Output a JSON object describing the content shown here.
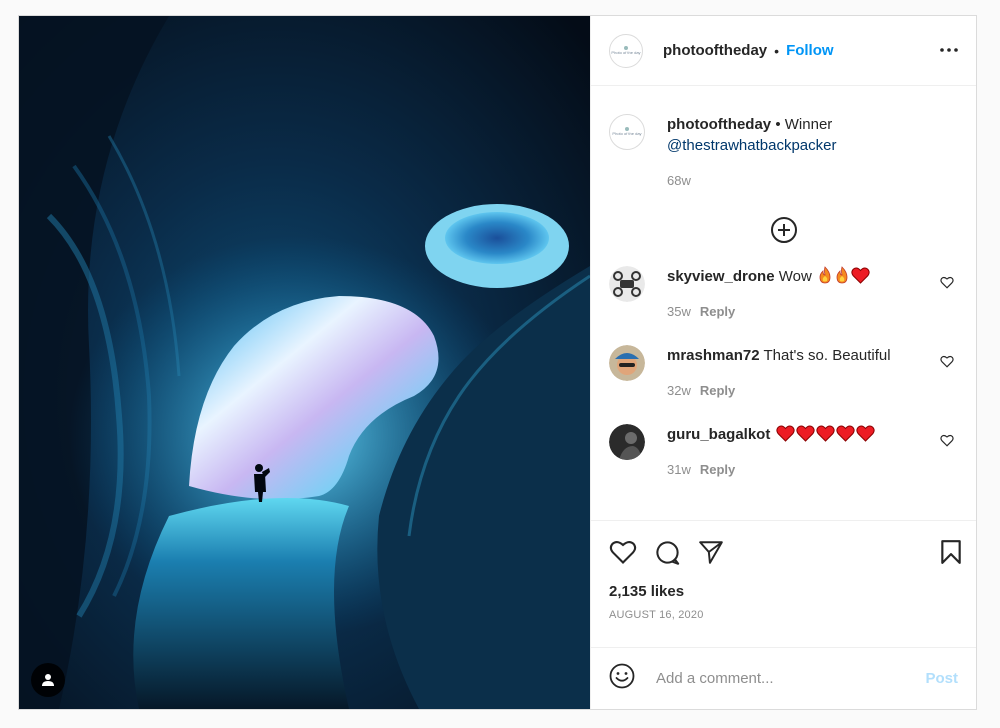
{
  "header": {
    "username": "photooftheday",
    "separator": "•",
    "follow_label": "Follow",
    "more_label": "•••",
    "avatar_text": "Photo of the day"
  },
  "caption": {
    "username": "photooftheday",
    "separator": "•",
    "text": "Winner",
    "mention": "@thestrawhatbackpacker",
    "time": "68w"
  },
  "comments": [
    {
      "username": "skyview_drone",
      "text": "Wow",
      "emojis": [
        "fire-emoji",
        "fire-emoji",
        "heart-emoji"
      ],
      "time": "35w",
      "reply_label": "Reply"
    },
    {
      "username": "mrashman72",
      "text": "That's so. Beautiful",
      "emojis": [],
      "time": "32w",
      "reply_label": "Reply"
    },
    {
      "username": "guru_bagalkot",
      "text": "",
      "emojis": [
        "heart-emoji",
        "heart-emoji",
        "heart-emoji",
        "heart-emoji",
        "heart-emoji"
      ],
      "time": "31w",
      "reply_label": "Reply"
    }
  ],
  "actions": {
    "icons": [
      "heart-outline-icon",
      "comment-icon",
      "share-icon",
      "bookmark-icon"
    ]
  },
  "likes": "2,135 likes",
  "date": "AUGUST 16, 2020",
  "add_comment": {
    "placeholder": "Add a comment...",
    "post_label": "Post"
  },
  "colors": {
    "accent": "#0095f6",
    "mention": "#00376b",
    "post_disabled": "#b2dffc",
    "muted": "#8e8e8e",
    "heart_red": "#ed1c24",
    "fire_orange": "#f58a1f"
  }
}
